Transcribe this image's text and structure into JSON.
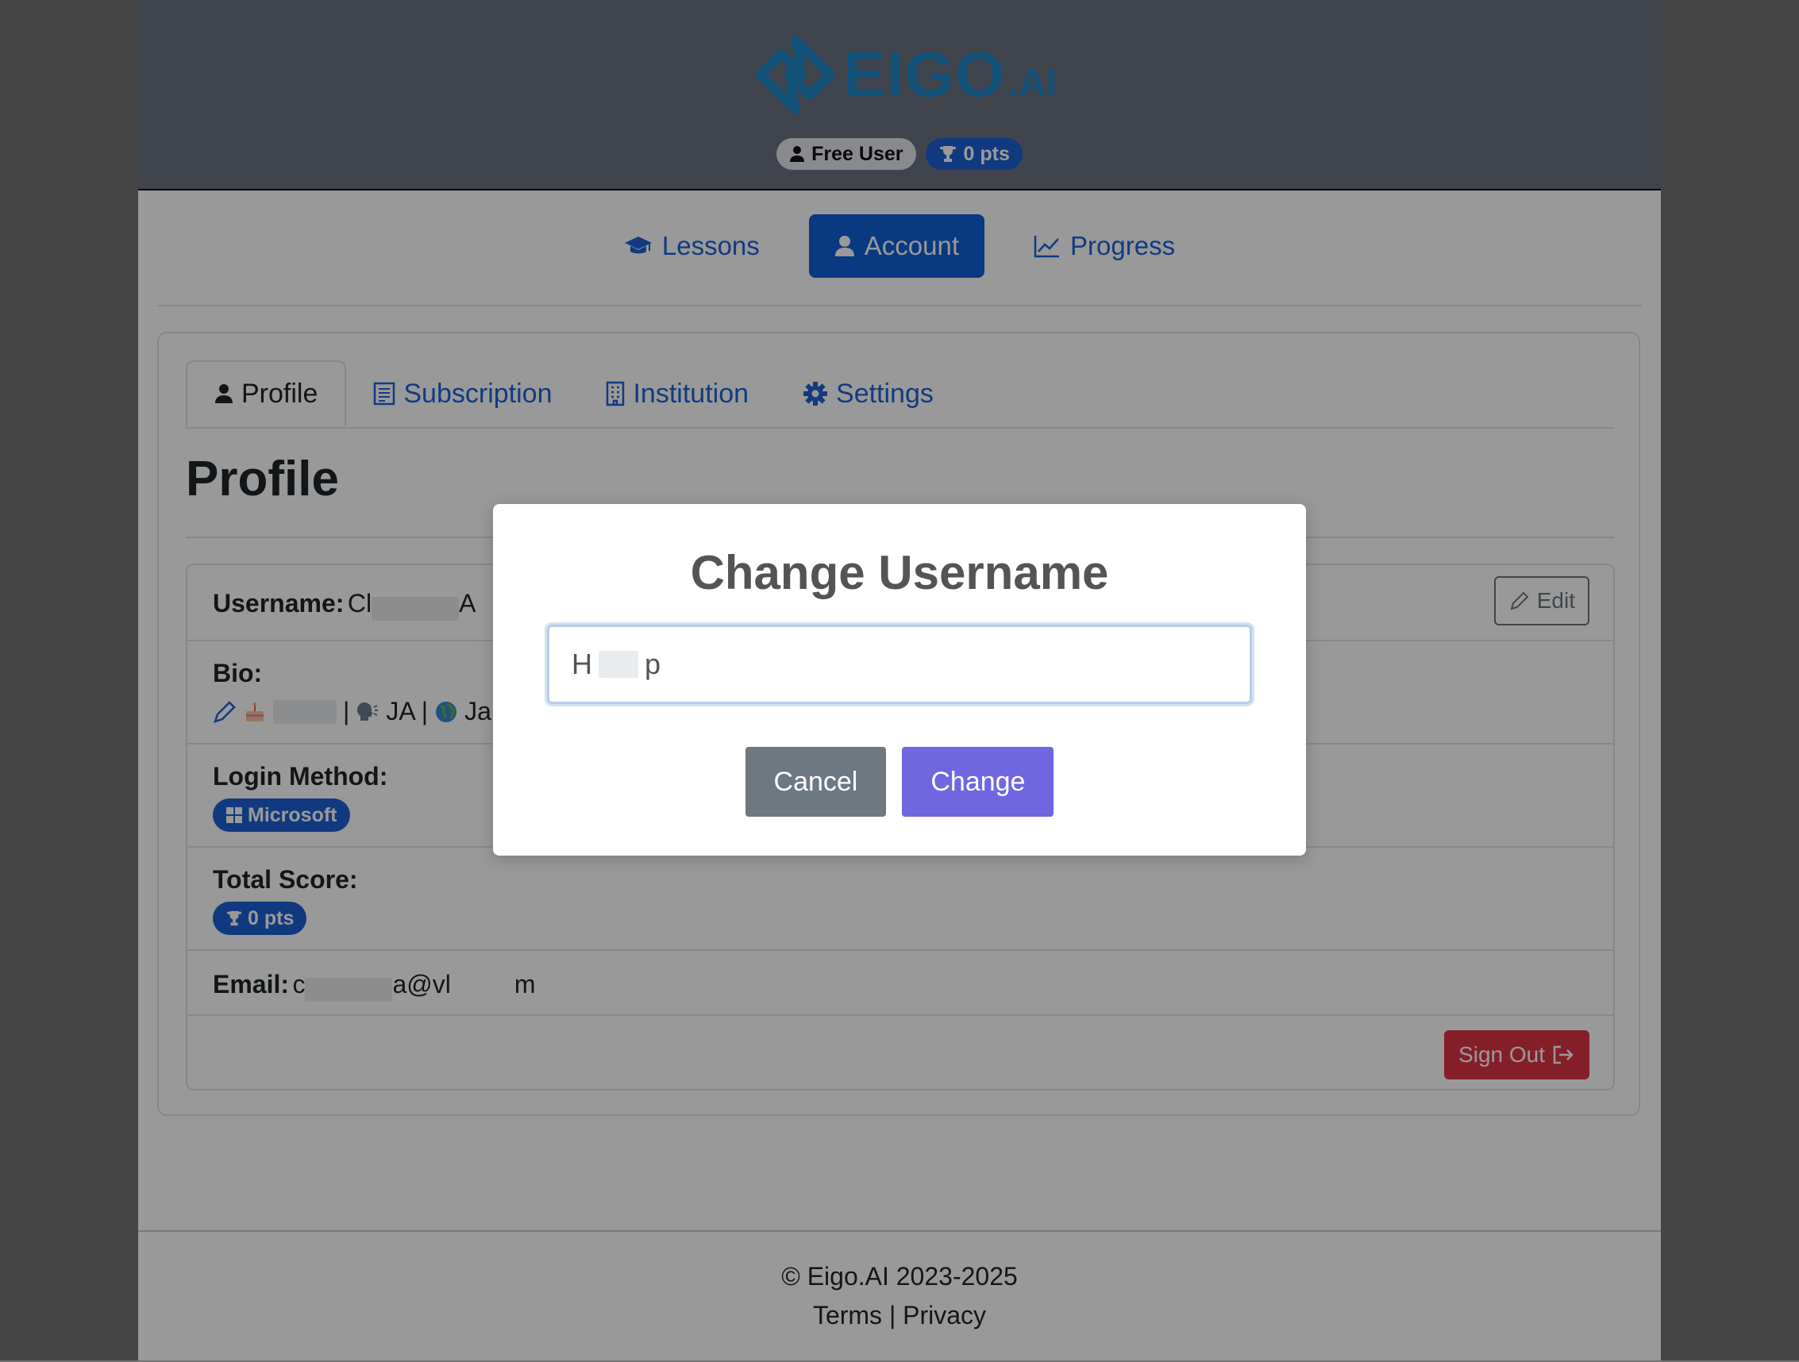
{
  "header": {
    "logo_text": "EIGO",
    "logo_suffix": ".AI",
    "user_status": "Free User",
    "points_badge": "0 pts"
  },
  "nav": {
    "lessons": "Lessons",
    "account": "Account",
    "progress": "Progress"
  },
  "tabs": {
    "profile": "Profile",
    "subscription": "Subscription",
    "institution": "Institution",
    "settings": "Settings"
  },
  "profile": {
    "title": "Profile",
    "username_label": "Username:",
    "username_prefix": "Cl",
    "username_suffix": "A",
    "edit_label": "Edit",
    "bio_label": "Bio:",
    "bio_lang": "JA |",
    "bio_country": "Ja",
    "login_label": "Login Method:",
    "login_method": "Microsoft",
    "score_label": "Total Score:",
    "score_value": "0 pts",
    "email_label": "Email:",
    "email_a": "c",
    "email_b": "a@vl",
    "email_c": "m",
    "signout_label": "Sign Out"
  },
  "footer": {
    "copyright": "© Eigo.AI 2023-2025",
    "terms": "Terms",
    "separator": "|",
    "privacy": "Privacy"
  },
  "modal": {
    "title": "Change Username",
    "input_prefix": "H",
    "input_suffix": "p",
    "cancel": "Cancel",
    "change": "Change"
  },
  "colors": {
    "primary": "#1060d6",
    "danger": "#dc3545",
    "modal_confirm": "#7066e0",
    "modal_cancel": "#6e7881",
    "logo": "#1e88c8"
  }
}
